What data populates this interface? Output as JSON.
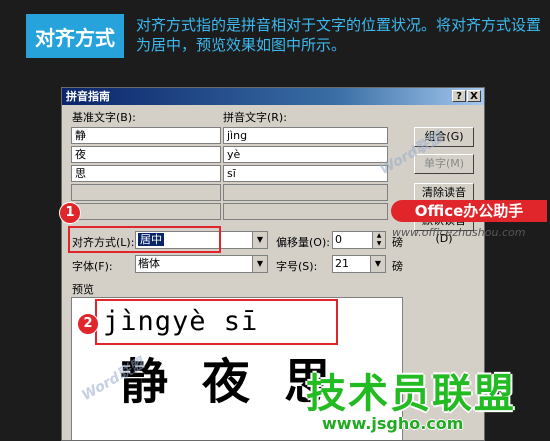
{
  "header": {
    "tag": "对齐方式",
    "description": "对齐方式指的是拼音相对于文字的位置状况。将对齐方式设置为居中，预览效果如图中所示。"
  },
  "dialog": {
    "title": "拼音指南",
    "help_button": "?",
    "close_button": "X",
    "base_text_label": "基准文字(B):",
    "pinyin_text_label": "拼音文字(R):",
    "rows": [
      {
        "base": "静",
        "pinyin": "jìng"
      },
      {
        "base": "夜",
        "pinyin": "yè"
      },
      {
        "base": "思",
        "pinyin": "sī"
      }
    ],
    "buttons": {
      "combine": "组合(G)",
      "single": "单字(M)",
      "clear": "清除读音(C)",
      "default": "默认读音(D)"
    },
    "alignment_label": "对齐方式(L):",
    "alignment_value": "居中",
    "offset_label": "偏移量(O):",
    "offset_value": "0",
    "offset_unit": "磅",
    "font_label": "字体(F):",
    "font_value": "楷体",
    "size_label": "字号(S):",
    "size_value": "21",
    "size_unit": "磅",
    "preview_label": "预览",
    "preview_pinyin": "jìngyè sī",
    "preview_hanzi": "静夜思"
  },
  "annotations": {
    "badge1": "1",
    "badge2": "2",
    "office_brand": "Office办公助手",
    "office_url": "www.officezhushou.com",
    "watermark": "Word联盟",
    "site_brand": "技术员联盟",
    "site_url": "www.jsgho.com"
  },
  "colors": {
    "accent": "#27a3dc",
    "annotation_red": "#e0262b",
    "brand_green": "#22bb22"
  }
}
